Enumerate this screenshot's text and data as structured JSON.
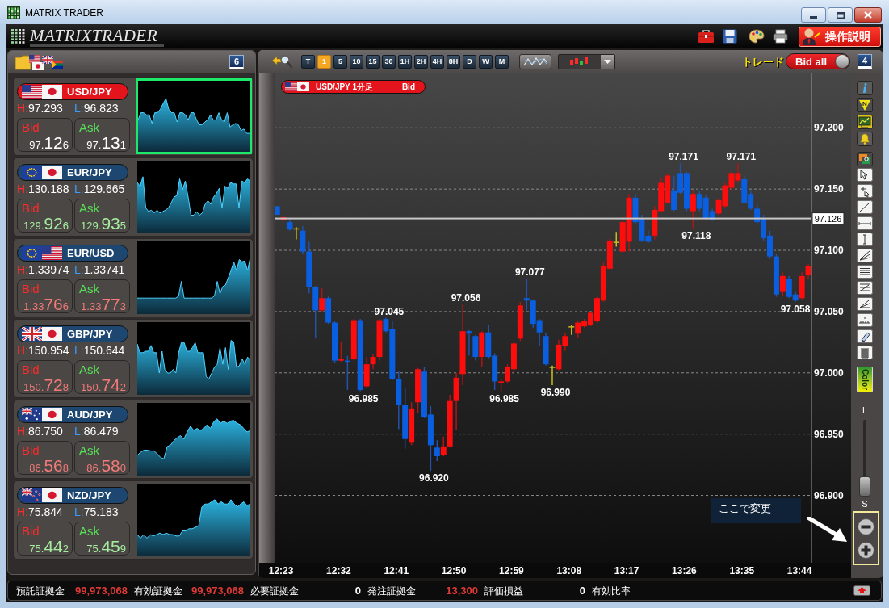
{
  "window": {
    "title": "MATRIX TRADER"
  },
  "header": {
    "logo": "MATRIXTRADER",
    "help_button": "操作説明"
  },
  "pairs_panel": {
    "count_badge": "6",
    "pairs": [
      {
        "name": "USD/JPY",
        "selected": true,
        "high_label": "H:",
        "high": "97.293",
        "low_label": "L:",
        "low": "96.823",
        "color": "#ffffff",
        "bid": {
          "label": "Bid",
          "small": "97.",
          "big": "12",
          "pip": "6"
        },
        "ask": {
          "label": "Ask",
          "small": "97.",
          "big": "13",
          "pip": "1"
        }
      },
      {
        "name": "EUR/JPY",
        "selected": false,
        "high_label": "H:",
        "high": "130.188",
        "low_label": "L:",
        "low": "129.665",
        "color": "#a6eca0",
        "bid": {
          "label": "Bid",
          "small": "129.",
          "big": "92",
          "pip": "6"
        },
        "ask": {
          "label": "Ask",
          "small": "129.",
          "big": "93",
          "pip": "5"
        }
      },
      {
        "name": "EUR/USD",
        "selected": false,
        "high_label": "H:",
        "high": "1.33974",
        "low_label": "L:",
        "low": "1.33741",
        "color": "#f27a78",
        "bid": {
          "label": "Bid",
          "small": "1.33",
          "big": "76",
          "pip": "6"
        },
        "ask": {
          "label": "Ask",
          "small": "1.33",
          "big": "77",
          "pip": "3"
        }
      },
      {
        "name": "GBP/JPY",
        "selected": false,
        "high_label": "H:",
        "high": "150.954",
        "low_label": "L:",
        "low": "150.644",
        "color": "#f27a78",
        "bid": {
          "label": "Bid",
          "small": "150.",
          "big": "72",
          "pip": "8"
        },
        "ask": {
          "label": "Ask",
          "small": "150.",
          "big": "74",
          "pip": "2"
        }
      },
      {
        "name": "AUD/JPY",
        "selected": false,
        "high_label": "H:",
        "high": "86.750",
        "low_label": "L:",
        "low": "86.479",
        "color": "#f27a78",
        "bid": {
          "label": "Bid",
          "small": "86.",
          "big": "56",
          "pip": "8"
        },
        "ask": {
          "label": "Ask",
          "small": "86.",
          "big": "58",
          "pip": "0"
        }
      },
      {
        "name": "NZD/JPY",
        "selected": false,
        "high_label": "H:",
        "high": "75.844",
        "low_label": "L:",
        "low": "75.183",
        "color": "#a6eca0",
        "bid": {
          "label": "Bid",
          "small": "75.",
          "big": "44",
          "pip": "2"
        },
        "ask": {
          "label": "Ask",
          "small": "75.",
          "big": "45",
          "pip": "9"
        }
      }
    ]
  },
  "chart_panel": {
    "timeframes": [
      {
        "label": "T",
        "selected": false
      },
      {
        "label": "1",
        "selected": true
      },
      {
        "label": "5",
        "selected": false
      },
      {
        "label": "10",
        "selected": false
      },
      {
        "label": "15",
        "selected": false
      },
      {
        "label": "30",
        "selected": false
      },
      {
        "label": "1H",
        "selected": false
      },
      {
        "label": "2H",
        "selected": false
      },
      {
        "label": "4H",
        "selected": false
      },
      {
        "label": "8H",
        "selected": false
      },
      {
        "label": "D",
        "selected": false
      },
      {
        "label": "W",
        "selected": false
      },
      {
        "label": "M",
        "selected": false
      }
    ],
    "trade_label": "トレード",
    "bid_all_toggle": {
      "label": "Bid all",
      "on": true
    },
    "count_badge": "4",
    "chart": {
      "symbol": "USD/JPY 1分足",
      "side": "Bid",
      "chart_data": {
        "type": "candlestick",
        "categories": [
          null,
          "12:23",
          null,
          null,
          null,
          null,
          null,
          null,
          null,
          null,
          "12:32",
          null,
          null,
          null,
          null,
          null,
          null,
          null,
          null,
          "12:41",
          null,
          null,
          null,
          null,
          null,
          null,
          null,
          null,
          "12:50",
          null,
          null,
          null,
          null,
          null,
          null,
          null,
          null,
          "12:59",
          null,
          null,
          null,
          null,
          null,
          null,
          null,
          null,
          "13:08",
          null,
          null,
          null,
          null,
          null,
          null,
          null,
          null,
          "13:17",
          null,
          null,
          null,
          null,
          null,
          null,
          null,
          null,
          "13:26",
          null,
          null,
          null,
          null,
          null,
          null,
          null,
          null,
          "13:35",
          null,
          null,
          null,
          null,
          null,
          null,
          null,
          null,
          "13:44",
          null
        ],
        "ohlc": [
          [
            97.136,
            97.136,
            97.129,
            97.129
          ],
          [
            97.125,
            97.128,
            97.124,
            97.127
          ],
          [
            97.123,
            97.126,
            97.116,
            97.117
          ],
          [
            97.118,
            97.119,
            97.109,
            97.118
          ],
          [
            97.116,
            97.12,
            97.097,
            97.099
          ],
          [
            97.099,
            97.107,
            97.065,
            97.07
          ],
          [
            97.07,
            97.071,
            97.028,
            97.051
          ],
          [
            97.051,
            97.069,
            97.05,
            97.061
          ],
          [
            97.061,
            97.063,
            97.04,
            97.041
          ],
          [
            97.041,
            97.042,
            97.008,
            97.01
          ],
          [
            97.01,
            97.025,
            97.009,
            97.011
          ],
          [
            97.01,
            97.014,
            96.986,
            97.009
          ],
          [
            97.011,
            97.044,
            97.01,
            97.043
          ],
          [
            97.043,
            97.044,
            96.985,
            96.986
          ],
          [
            96.989,
            97.013,
            96.988,
            97.007
          ],
          [
            97.007,
            97.015,
            97.003,
            97.013
          ],
          [
            97.013,
            97.044,
            97.01,
            97.043
          ],
          [
            97.044,
            97.045,
            97.033,
            97.034
          ],
          [
            97.036,
            97.042,
            96.994,
            96.995
          ],
          [
            96.995,
            97.001,
            96.954,
            96.974
          ],
          [
            96.974,
            96.988,
            96.938,
            96.946
          ],
          [
            96.943,
            96.976,
            96.941,
            96.971
          ],
          [
            96.976,
            97.004,
            96.967,
            97.003
          ],
          [
            97.001,
            97.005,
            96.963,
            96.964
          ],
          [
            96.966,
            96.973,
            96.92,
            96.941
          ],
          [
            96.939,
            96.945,
            96.928,
            96.932
          ],
          [
            96.933,
            96.948,
            96.932,
            96.94
          ],
          [
            96.94,
            96.982,
            96.939,
            96.977
          ],
          [
            96.977,
            97.0,
            96.953,
            96.996
          ],
          [
            96.999,
            97.056,
            96.99,
            97.034
          ],
          [
            97.034,
            97.035,
            97.014,
            97.032
          ],
          [
            97.03,
            97.031,
            97.01,
            97.013
          ],
          [
            97.013,
            97.034,
            97.005,
            97.033
          ],
          [
            97.033,
            97.039,
            97.012,
            97.013
          ],
          [
            97.014,
            97.016,
            96.986,
            96.993
          ],
          [
            96.992,
            96.995,
            96.985,
            96.993
          ],
          [
            96.993,
            97.007,
            96.992,
            97.005
          ],
          [
            97.003,
            97.025,
            97.0,
            97.024
          ],
          [
            97.028,
            97.058,
            97.026,
            97.055
          ],
          [
            97.061,
            97.077,
            97.051,
            97.059
          ],
          [
            97.059,
            97.06,
            97.037,
            97.04
          ],
          [
            97.043,
            97.044,
            97.022,
            97.033
          ],
          [
            97.03,
            97.033,
            97.006,
            97.007
          ],
          [
            97.005,
            97.006,
            96.99,
            97.005
          ],
          [
            97.003,
            97.027,
            97.002,
            97.023
          ],
          [
            97.022,
            97.033,
            97.018,
            97.03
          ],
          [
            97.038,
            97.039,
            97.031,
            97.038
          ],
          [
            97.032,
            97.042,
            97.029,
            97.041
          ],
          [
            97.038,
            97.044,
            97.037,
            97.042
          ],
          [
            97.039,
            97.05,
            97.038,
            97.049
          ],
          [
            97.042,
            97.062,
            97.041,
            97.061
          ],
          [
            97.059,
            97.09,
            97.058,
            97.087
          ],
          [
            97.085,
            97.11,
            97.084,
            97.108
          ],
          [
            97.107,
            97.115,
            97.103,
            97.107
          ],
          [
            97.099,
            97.128,
            97.098,
            97.123
          ],
          [
            97.107,
            97.146,
            97.099,
            97.143
          ],
          [
            97.143,
            97.146,
            97.122,
            97.123
          ],
          [
            97.126,
            97.129,
            97.107,
            97.108
          ],
          [
            97.112,
            97.116,
            97.106,
            97.107
          ],
          [
            97.112,
            97.136,
            97.109,
            97.133
          ],
          [
            97.132,
            97.159,
            97.131,
            97.155
          ],
          [
            97.139,
            97.163,
            97.138,
            97.161
          ],
          [
            97.149,
            97.161,
            97.132,
            97.133
          ],
          [
            97.163,
            97.171,
            97.146,
            97.147
          ],
          [
            97.163,
            97.164,
            97.132,
            97.134
          ],
          [
            97.132,
            97.149,
            97.118,
            97.146
          ],
          [
            97.146,
            97.149,
            97.132,
            97.134
          ],
          [
            97.143,
            97.145,
            97.125,
            97.126
          ],
          [
            97.132,
            97.134,
            97.124,
            97.125
          ],
          [
            97.13,
            97.143,
            97.128,
            97.141
          ],
          [
            97.136,
            97.155,
            97.135,
            97.153
          ],
          [
            97.151,
            97.164,
            97.149,
            97.163
          ],
          [
            97.157,
            97.171,
            97.155,
            97.163
          ],
          [
            97.158,
            97.161,
            97.138,
            97.139
          ],
          [
            97.146,
            97.149,
            97.133,
            97.134
          ],
          [
            97.134,
            97.138,
            97.121,
            97.123
          ],
          [
            97.126,
            97.129,
            97.108,
            97.11
          ],
          [
            97.112,
            97.116,
            97.093,
            97.095
          ],
          [
            97.095,
            97.097,
            97.062,
            97.064
          ],
          [
            97.066,
            97.082,
            97.063,
            97.079
          ],
          [
            97.077,
            97.079,
            97.061,
            97.062
          ],
          [
            97.064,
            97.066,
            97.058,
            97.059
          ],
          [
            97.061,
            97.082,
            97.06,
            97.079
          ],
          [
            97.08,
            97.089,
            97.077,
            97.087
          ]
        ],
        "ylim": [
          96.845,
          97.245
        ],
        "yticks": [
          {
            "value": 97.2,
            "label": "97.200"
          },
          {
            "value": 97.15,
            "label": "97.150"
          },
          {
            "value": 97.1,
            "label": "97.100"
          },
          {
            "value": 97.05,
            "label": "97.050"
          },
          {
            "value": 97.0,
            "label": "97.000"
          },
          {
            "value": 96.95,
            "label": "96.950"
          },
          {
            "value": 96.9,
            "label": "96.900"
          }
        ],
        "grid": true,
        "annotations": [
          {
            "y": 96.985,
            "text": "96.985"
          },
          {
            "y": 97.045,
            "text": "97.045"
          },
          {
            "y": 96.92,
            "text": "96.920"
          },
          {
            "y": 97.056,
            "text": "97.056"
          },
          {
            "y": 96.985,
            "text": "96.985"
          },
          {
            "y": 97.077,
            "text": "97.077"
          },
          {
            "y": 96.99,
            "text": "96.990"
          },
          {
            "y": 97.171,
            "text": "97.171"
          },
          {
            "y": 97.118,
            "text": "97.118"
          },
          {
            "y": 97.171,
            "text": "97.171"
          },
          {
            "y": 97.058,
            "text": "97.058"
          }
        ],
        "ref_lines": [
          {
            "axis": "y",
            "value": 97.126,
            "label": "97.126"
          }
        ]
      }
    },
    "side_tools": {
      "news_button": "N",
      "color_button": "Color",
      "size_slider": {
        "top_label": "L",
        "bottom_label": "S",
        "level": 0
      }
    },
    "callout": "ここで変更"
  },
  "status_bar": {
    "items": [
      {
        "label": "預託証拠金",
        "value": "99,973,068",
        "color": "#e03a36"
      },
      {
        "label": "有効証拠金",
        "value": "99,973,068",
        "color": "#e03a36"
      },
      {
        "label": "必要証拠金",
        "value": "0",
        "color": "#ffffff"
      },
      {
        "label": "発注証拠金",
        "value": "13,300",
        "color": "#e03a36"
      },
      {
        "label": "評価損益",
        "value": "0",
        "color": "#ffffff"
      },
      {
        "label": "有効比率"
      }
    ]
  }
}
